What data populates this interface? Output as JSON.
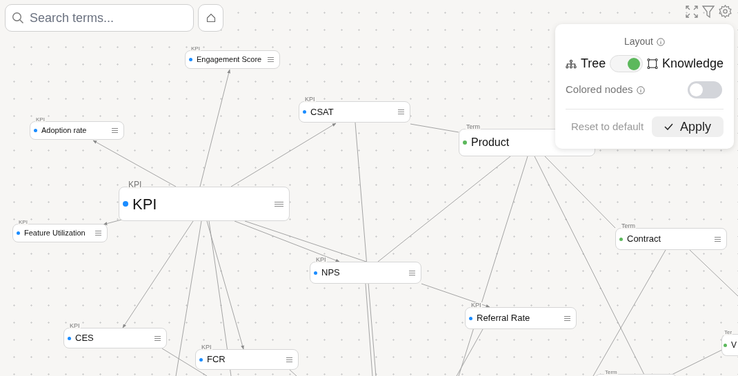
{
  "search": {
    "placeholder": "Search terms..."
  },
  "nodes": [
    {
      "type": "KPI",
      "name": "Engagement Score",
      "kind": "small",
      "color": "#1a8cff"
    },
    {
      "type": "KPI",
      "name": "CSAT",
      "kind": "medium",
      "color": "#1a8cff"
    },
    {
      "type": "KPI",
      "name": "Adoption rate",
      "kind": "small",
      "color": "#1a8cff"
    },
    {
      "type": "Term",
      "name": "Product",
      "kind": "wide",
      "color": "#5cb85c"
    },
    {
      "type": "KPI",
      "name": "KPI",
      "kind": "large",
      "color": "#1a8cff"
    },
    {
      "type": "KPI",
      "name": "Feature Utilization",
      "kind": "small",
      "color": "#1a8cff"
    },
    {
      "type": "Term",
      "name": "Contract",
      "kind": "medium",
      "color": "#5cb85c"
    },
    {
      "type": "KPI",
      "name": "NPS",
      "kind": "medium",
      "color": "#1a8cff"
    },
    {
      "type": "KPI",
      "name": "Referral Rate",
      "kind": "medium",
      "color": "#1a8cff"
    },
    {
      "type": "KPI",
      "name": "CES",
      "kind": "medium",
      "color": "#1a8cff"
    },
    {
      "type": "Ter",
      "name": "V",
      "kind": "edge",
      "color": "#5cb85c"
    },
    {
      "type": "KPI",
      "name": "FCR",
      "kind": "medium",
      "color": "#1a8cff"
    },
    {
      "type": "Term",
      "kind": "hidden"
    }
  ],
  "settings": {
    "title": "Layout",
    "left_label": "Tree",
    "right_label": "Knowledge",
    "layout_on": true,
    "colored_nodes": {
      "label": "Colored nodes",
      "on": false
    },
    "reset": "Reset to default",
    "apply": "Apply"
  }
}
